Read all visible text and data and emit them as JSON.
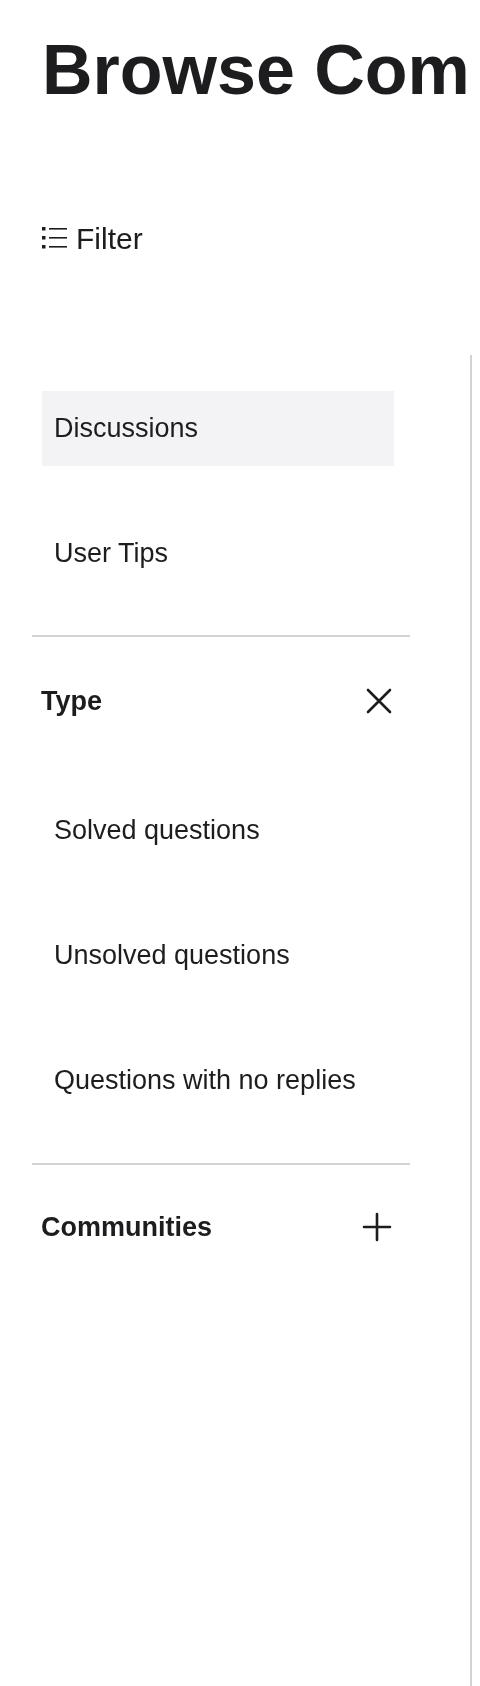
{
  "title": "Browse Com",
  "filter": {
    "label": "Filter"
  },
  "groups": [
    {
      "items": [
        {
          "label": "Discussions",
          "selected": true
        },
        {
          "label": "User Tips",
          "selected": false
        }
      ]
    },
    {
      "heading": "Type",
      "expanded": true,
      "items": [
        {
          "label": "Solved questions",
          "selected": false
        },
        {
          "label": "Unsolved questions",
          "selected": false
        },
        {
          "label": "Questions with no replies",
          "selected": false
        }
      ]
    },
    {
      "heading": "Communities",
      "expanded": false
    }
  ]
}
